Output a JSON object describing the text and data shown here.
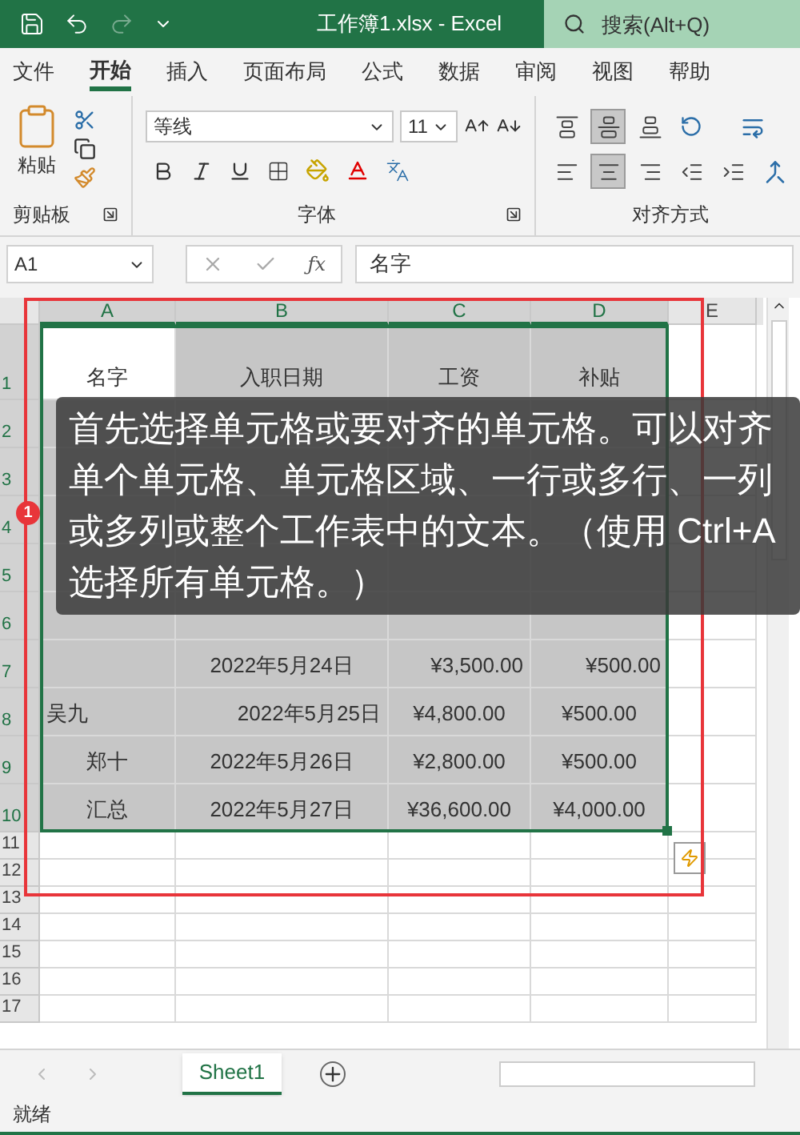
{
  "title_bar": {
    "title": "工作簿1.xlsx  -  Excel",
    "search": {
      "placeholder": "搜索(Alt+Q)"
    },
    "redo_disabled": true
  },
  "menu_tabs": [
    {
      "label": "文件",
      "selected": false
    },
    {
      "label": "开始",
      "selected": true
    },
    {
      "label": "插入",
      "selected": false
    },
    {
      "label": "页面布局",
      "selected": false
    },
    {
      "label": "公式",
      "selected": false
    },
    {
      "label": "数据",
      "selected": false
    },
    {
      "label": "审阅",
      "selected": false
    },
    {
      "label": "视图",
      "selected": false
    },
    {
      "label": "帮助",
      "selected": false
    }
  ],
  "ribbon": {
    "clipboard": {
      "paste_label": "粘贴",
      "group_label": "剪贴板"
    },
    "font": {
      "font_name": "等线",
      "font_size": "11",
      "group_label": "字体"
    },
    "alignment": {
      "group_label": "对齐方式",
      "top_row": [
        {
          "kind": "top",
          "selected": false
        },
        {
          "kind": "middle",
          "selected": true
        },
        {
          "kind": "bottom",
          "selected": false
        }
      ],
      "bottom_row": [
        {
          "kind": "left",
          "selected": false
        },
        {
          "kind": "center",
          "selected": true
        },
        {
          "kind": "right",
          "selected": false
        },
        {
          "kind": "outdent",
          "selected": false
        },
        {
          "kind": "indent",
          "selected": false
        }
      ]
    }
  },
  "formula_bar": {
    "name_box": "A1",
    "fx_label": "ƒx",
    "value": "名字"
  },
  "grid": {
    "columns": [
      {
        "label": "A",
        "selected": true
      },
      {
        "label": "B",
        "selected": true
      },
      {
        "label": "C",
        "selected": true
      },
      {
        "label": "D",
        "selected": true
      },
      {
        "label": "E",
        "selected": false
      }
    ],
    "rows": [
      {
        "number": "1",
        "selected": true,
        "cells": [
          {
            "text": "名字",
            "active": true
          },
          {
            "text": "入职日期",
            "active": false
          },
          {
            "text": "工资",
            "active": false
          },
          {
            "text": "补贴",
            "active": false
          }
        ]
      },
      {
        "number": "2",
        "selected": true
      },
      {
        "number": "3",
        "selected": true
      },
      {
        "number": "4",
        "selected": true
      },
      {
        "number": "5",
        "selected": true
      },
      {
        "number": "6",
        "selected": true
      },
      {
        "number": "7",
        "selected": true,
        "cells": [
          {
            "active": false
          },
          {
            "text": "2022年5月24日",
            "active": false
          },
          {
            "text": "¥3,500.00",
            "active": false
          },
          {
            "text": "¥500.00",
            "active": false
          }
        ]
      },
      {
        "number": "8",
        "selected": true,
        "cells": [
          {
            "text": "吴九",
            "active": false
          },
          {
            "text": "2022年5月25日",
            "active": false
          },
          {
            "text": "¥4,800.00",
            "active": false
          },
          {
            "text": "¥500.00",
            "active": false
          }
        ]
      },
      {
        "number": "9",
        "selected": true,
        "cells": [
          {
            "text": "郑十",
            "active": false
          },
          {
            "text": "2022年5月26日",
            "active": false
          },
          {
            "text": "¥2,800.00",
            "active": false
          },
          {
            "text": "¥500.00",
            "active": false
          }
        ]
      },
      {
        "number": "10",
        "selected": true,
        "cells": [
          {
            "text": "汇总",
            "active": false
          },
          {
            "text": "2022年5月27日",
            "active": false
          },
          {
            "text": "¥36,600.00",
            "active": false
          },
          {
            "text": "¥4,000.00",
            "active": false
          }
        ]
      },
      {
        "number": "11",
        "selected": false
      },
      {
        "number": "12",
        "selected": false
      },
      {
        "number": "13",
        "selected": false
      },
      {
        "number": "14",
        "selected": false
      },
      {
        "number": "15",
        "selected": false
      },
      {
        "number": "16",
        "selected": false
      },
      {
        "number": "17",
        "selected": false
      }
    ]
  },
  "sheet_tabs": [
    {
      "label": "Sheet1",
      "selected": true
    }
  ],
  "status_bar": {
    "text": "就绪"
  },
  "annotation": {
    "badge": "1",
    "text": "首先选择单元格或要对齐的单元格。可以对齐单个单元格、单元格区域、一行或多行、一列或多列或整个工作表中的文本。（使用 Ctrl+A 选择所有单元格。）"
  }
}
